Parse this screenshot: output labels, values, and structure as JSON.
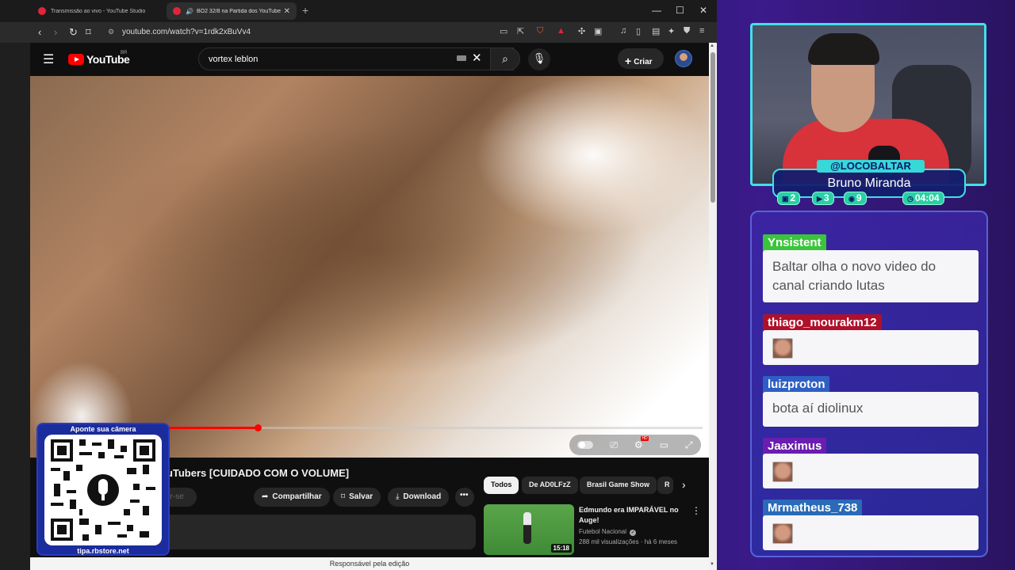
{
  "browser": {
    "tabs": [
      {
        "title": "Transmissão ao vivo - YouTube Studio",
        "active": false
      },
      {
        "title": "BO2 32/8 na Partida dos YouTubers",
        "active": true
      }
    ],
    "url": "youtube.com/watch?v=1rdk2xBuVv4",
    "ext_badge": "1"
  },
  "youtube": {
    "logo": "YouTube",
    "region": "BR",
    "search_value": "vortex leblon",
    "create_label": "Criar",
    "video_title_fragment": "ouTubers [CUIDADO COM O VOLUME]",
    "subscribe_fragment": "ver-se",
    "actions": {
      "share": "Compartilhar",
      "save": "Salvar",
      "download": "Download"
    },
    "chips": [
      "Todos",
      "De AD0LFzZ",
      "Brasil Game Show",
      "R"
    ],
    "progress_fraction": 0.33,
    "recommended": {
      "title": "Edmundo era IMPARÁVEL no Auge!",
      "channel": "Futebol Nacional",
      "meta": "288 mil visualizações · há 6 meses",
      "duration": "15:18"
    },
    "status_bar": "Responsável pela edição"
  },
  "qr": {
    "top_label": "Aponte sua câmera",
    "bottom_label": "tipa.rbstore.net"
  },
  "stream": {
    "handle": "@LOCOBALTAR",
    "name": "Bruno Miranda",
    "stats": {
      "twitch": "2",
      "youtube": "3",
      "kick": "9",
      "timer": "04:04"
    }
  },
  "chat": [
    {
      "user": "Ynsistent",
      "color": "#3cc43c",
      "message": "Baltar olha o novo video do canal criando lutas",
      "emote": false
    },
    {
      "user": "thiago_mourakm12",
      "color": "#b0102a",
      "message": "",
      "emote": true
    },
    {
      "user": "luizproton",
      "color": "#2f5fc4",
      "message": "bota aí diolinux",
      "emote": false
    },
    {
      "user": "Jaaximus",
      "color": "#6a1db0",
      "message": "",
      "emote": true
    },
    {
      "user": "Mrmatheus_738",
      "color": "#2a6ab8",
      "message": "",
      "emote": true
    }
  ],
  "icons": {
    "menu": "hamburger-icon",
    "search": "search-icon",
    "mic": "microphone-icon",
    "settings": "gear-icon"
  }
}
